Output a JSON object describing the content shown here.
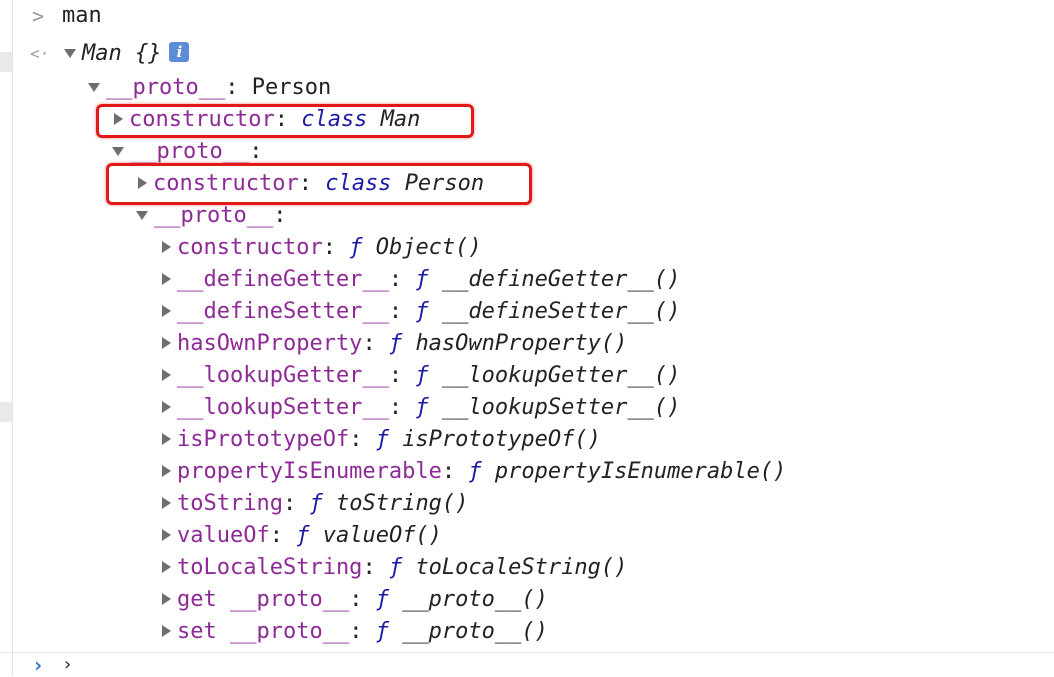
{
  "console": {
    "input_prompt_glyph": ">",
    "result_prompt_glyph": "<·",
    "command": "man",
    "root_label": "Man {}",
    "info_badge": "i",
    "proto_key": "__proto__",
    "proto_value": "Person",
    "man_constructor": {
      "key": "constructor",
      "kw": "class",
      "name": "Man"
    },
    "inner_proto_key": "__proto__",
    "person_constructor": {
      "key": "constructor",
      "kw": "class",
      "name": "Person"
    },
    "object_proto_key": "__proto__",
    "object_members": [
      {
        "key": "constructor",
        "f": "ƒ",
        "fn": "Object()"
      },
      {
        "key": "__defineGetter__",
        "f": "ƒ",
        "fn": "__defineGetter__()"
      },
      {
        "key": "__defineSetter__",
        "f": "ƒ",
        "fn": "__defineSetter__()"
      },
      {
        "key": "hasOwnProperty",
        "f": "ƒ",
        "fn": "hasOwnProperty()"
      },
      {
        "key": "__lookupGetter__",
        "f": "ƒ",
        "fn": "__lookupGetter__()"
      },
      {
        "key": "__lookupSetter__",
        "f": "ƒ",
        "fn": "__lookupSetter__()"
      },
      {
        "key": "isPrototypeOf",
        "f": "ƒ",
        "fn": "isPrototypeOf()"
      },
      {
        "key": "propertyIsEnumerable",
        "f": "ƒ",
        "fn": "propertyIsEnumerable()"
      },
      {
        "key": "toString",
        "f": "ƒ",
        "fn": "toString()"
      },
      {
        "key": "valueOf",
        "f": "ƒ",
        "fn": "valueOf()"
      },
      {
        "key": "toLocaleString",
        "f": "ƒ",
        "fn": "toLocaleString()"
      },
      {
        "key": "get __proto__",
        "f": "ƒ",
        "fn": "__proto__()"
      },
      {
        "key": "set __proto__",
        "f": "ƒ",
        "fn": "__proto__()"
      }
    ],
    "bottom_prompt_glyph": "›",
    "bottom_caret": "›"
  },
  "colors": {
    "key": "#8e2a96",
    "function_keyword": "#1a1aa6",
    "highlight_border": "#e11919",
    "prompt_blue": "#2b6fd6"
  }
}
